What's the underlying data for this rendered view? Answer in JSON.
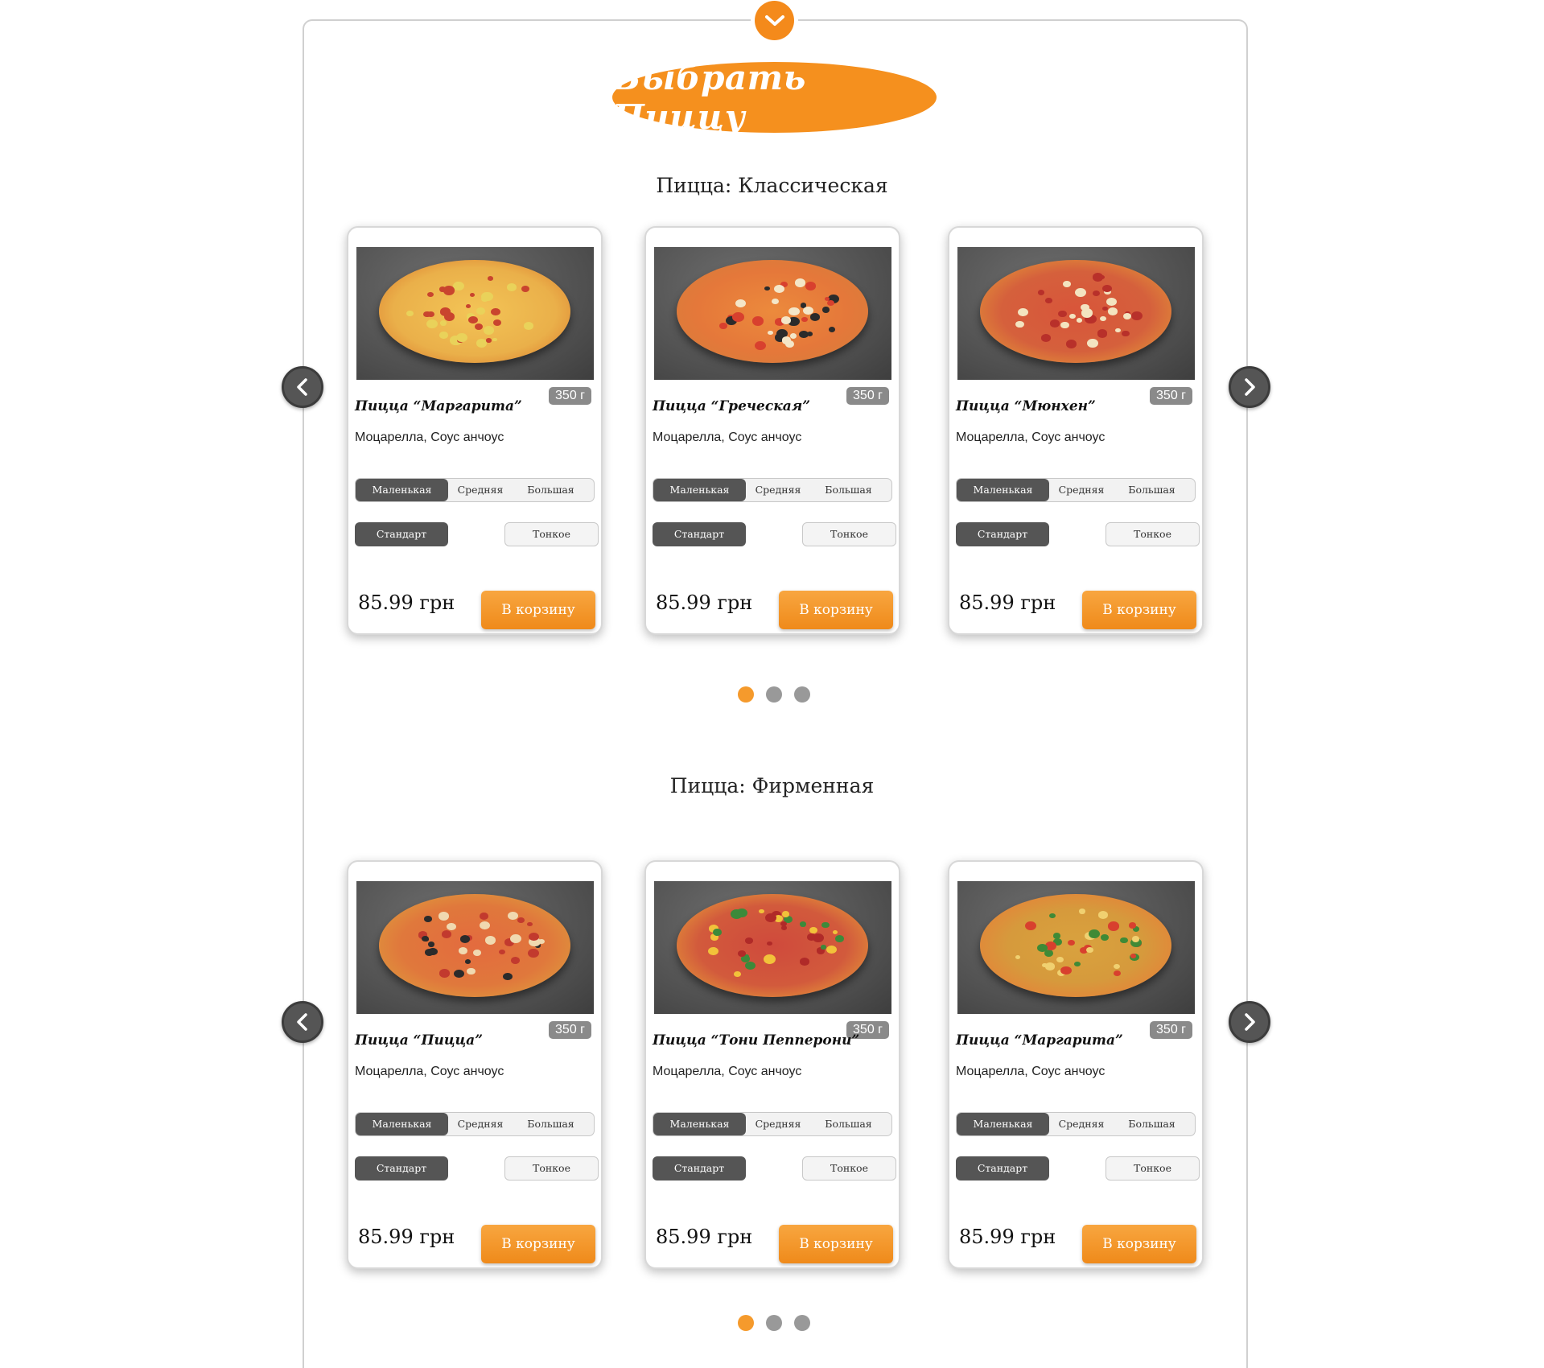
{
  "header": {
    "toggle_icon": "chevron-down-icon",
    "title": "Выбрать Пиццу",
    "accent_color": "#f5901e"
  },
  "sections": [
    {
      "title": "Пицца: Классическая",
      "cards": [
        {
          "name": "Пицца “Маргарита”",
          "weight": "350 г",
          "ingredients": "Моцарелла, Соус анчоус",
          "sizes": [
            "Маленькая",
            "Средняя",
            "Большая"
          ],
          "selected_size": "Маленькая",
          "crusts": [
            "Стандарт",
            "Тонкое"
          ],
          "selected_crust": "Стандарт",
          "price": "85.99 грн",
          "cart_label": "В корзину"
        },
        {
          "name": "Пицца “Греческая”",
          "weight": "350 г",
          "ingredients": "Моцарелла, Соус анчоус",
          "sizes": [
            "Маленькая",
            "Средняя",
            "Большая"
          ],
          "selected_size": "Маленькая",
          "crusts": [
            "Стандарт",
            "Тонкое"
          ],
          "selected_crust": "Стандарт",
          "price": "85.99 грн",
          "cart_label": "В корзину"
        },
        {
          "name": "Пицца “Мюнхен”",
          "weight": "350 г",
          "ingredients": "Моцарелла, Соус анчоус",
          "sizes": [
            "Маленькая",
            "Средняя",
            "Большая"
          ],
          "selected_size": "Маленькая",
          "crusts": [
            "Стандарт",
            "Тонкое"
          ],
          "selected_crust": "Стандарт",
          "price": "85.99 грн",
          "cart_label": "В корзину"
        }
      ],
      "pagination": {
        "count": 3,
        "active": 1
      }
    },
    {
      "title": "Пицца: Фирменная",
      "cards": [
        {
          "name": "Пицца “Пицца”",
          "weight": "350 г",
          "ingredients": "Моцарелла, Соус анчоус",
          "sizes": [
            "Маленькая",
            "Средняя",
            "Большая"
          ],
          "selected_size": "Маленькая",
          "crusts": [
            "Стандарт",
            "Тонкое"
          ],
          "selected_crust": "Стандарт",
          "price": "85.99 грн",
          "cart_label": "В корзину"
        },
        {
          "name": "Пицца “Тони Пепперони”",
          "weight": "350 г",
          "ingredients": "Моцарелла, Соус анчоус",
          "sizes": [
            "Маленькая",
            "Средняя",
            "Большая"
          ],
          "selected_size": "Маленькая",
          "crusts": [
            "Стандарт",
            "Тонкое"
          ],
          "selected_crust": "Стандарт",
          "price": "85.99 грн",
          "cart_label": "В корзину"
        },
        {
          "name": "Пицца “Маргарита”",
          "weight": "350 г",
          "ingredients": "Моцарелла, Соус анчоус",
          "sizes": [
            "Маленькая",
            "Средняя",
            "Большая"
          ],
          "selected_size": "Маленькая",
          "crusts": [
            "Стандарт",
            "Тонкое"
          ],
          "selected_crust": "Стандарт",
          "price": "85.99 грн",
          "cart_label": "В корзину"
        }
      ],
      "pagination": {
        "count": 3,
        "active": 1
      }
    }
  ],
  "icons": {
    "prev": "chevron-left-icon",
    "next": "chevron-right-icon"
  },
  "colors": {
    "button": "#f5901e",
    "dot_active": "#f59a2c",
    "dot_inactive": "#999999",
    "control_dark": "#555555"
  }
}
